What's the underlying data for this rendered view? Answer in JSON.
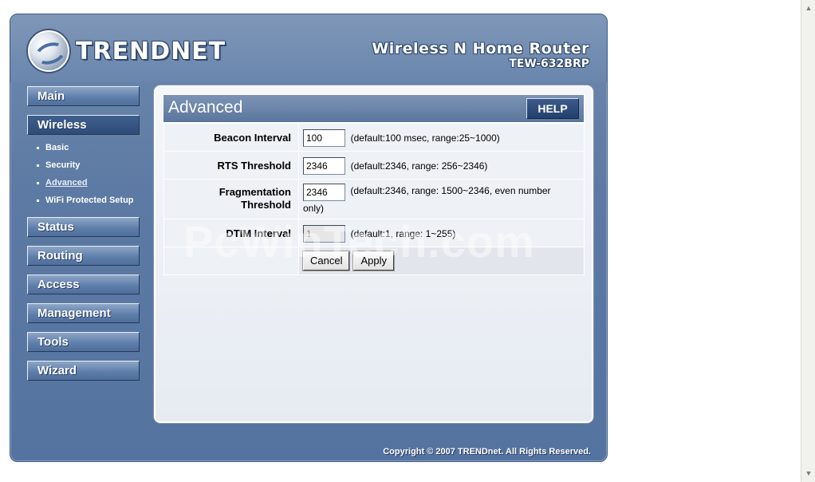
{
  "header": {
    "brand": "TRENDNET",
    "product_name": "Wireless N Home Router",
    "model": "TEW-632BRP"
  },
  "sidebar": {
    "items": [
      {
        "label": "Main"
      },
      {
        "label": "Wireless",
        "active": true
      },
      {
        "label": "Status"
      },
      {
        "label": "Routing"
      },
      {
        "label": "Access"
      },
      {
        "label": "Management"
      },
      {
        "label": "Tools"
      },
      {
        "label": "Wizard"
      }
    ],
    "wireless_sub": [
      {
        "label": "Basic"
      },
      {
        "label": "Security"
      },
      {
        "label": "Advanced",
        "current": true
      },
      {
        "label": "WiFi Protected Setup"
      }
    ]
  },
  "panel": {
    "title": "Advanced",
    "help_label": "HELP",
    "fields": [
      {
        "label": "Beacon Interval",
        "value": "100",
        "hint": "(default:100 msec, range:25~1000)"
      },
      {
        "label": "RTS Threshold",
        "value": "2346",
        "hint": "(default:2346, range: 256~2346)"
      },
      {
        "label_line1": "Fragmentation",
        "label_line2": "Threshold",
        "value": "2346",
        "hint": "(default:2346, range: 1500~2346, even number only)"
      },
      {
        "label": "DTIM Interval",
        "value": "1",
        "hint": "(default:1, range: 1~255)",
        "disabled": true
      }
    ],
    "cancel_label": "Cancel",
    "apply_label": "Apply"
  },
  "watermark": "PcWinTech.com",
  "footer": {
    "copyright": "Copyright © 2007 TRENDnet. All Rights Reserved."
  },
  "colors": {
    "frame": "#5c7aa3",
    "panel_header": "#6a84a8",
    "panel_bg": "#eef1f5"
  }
}
